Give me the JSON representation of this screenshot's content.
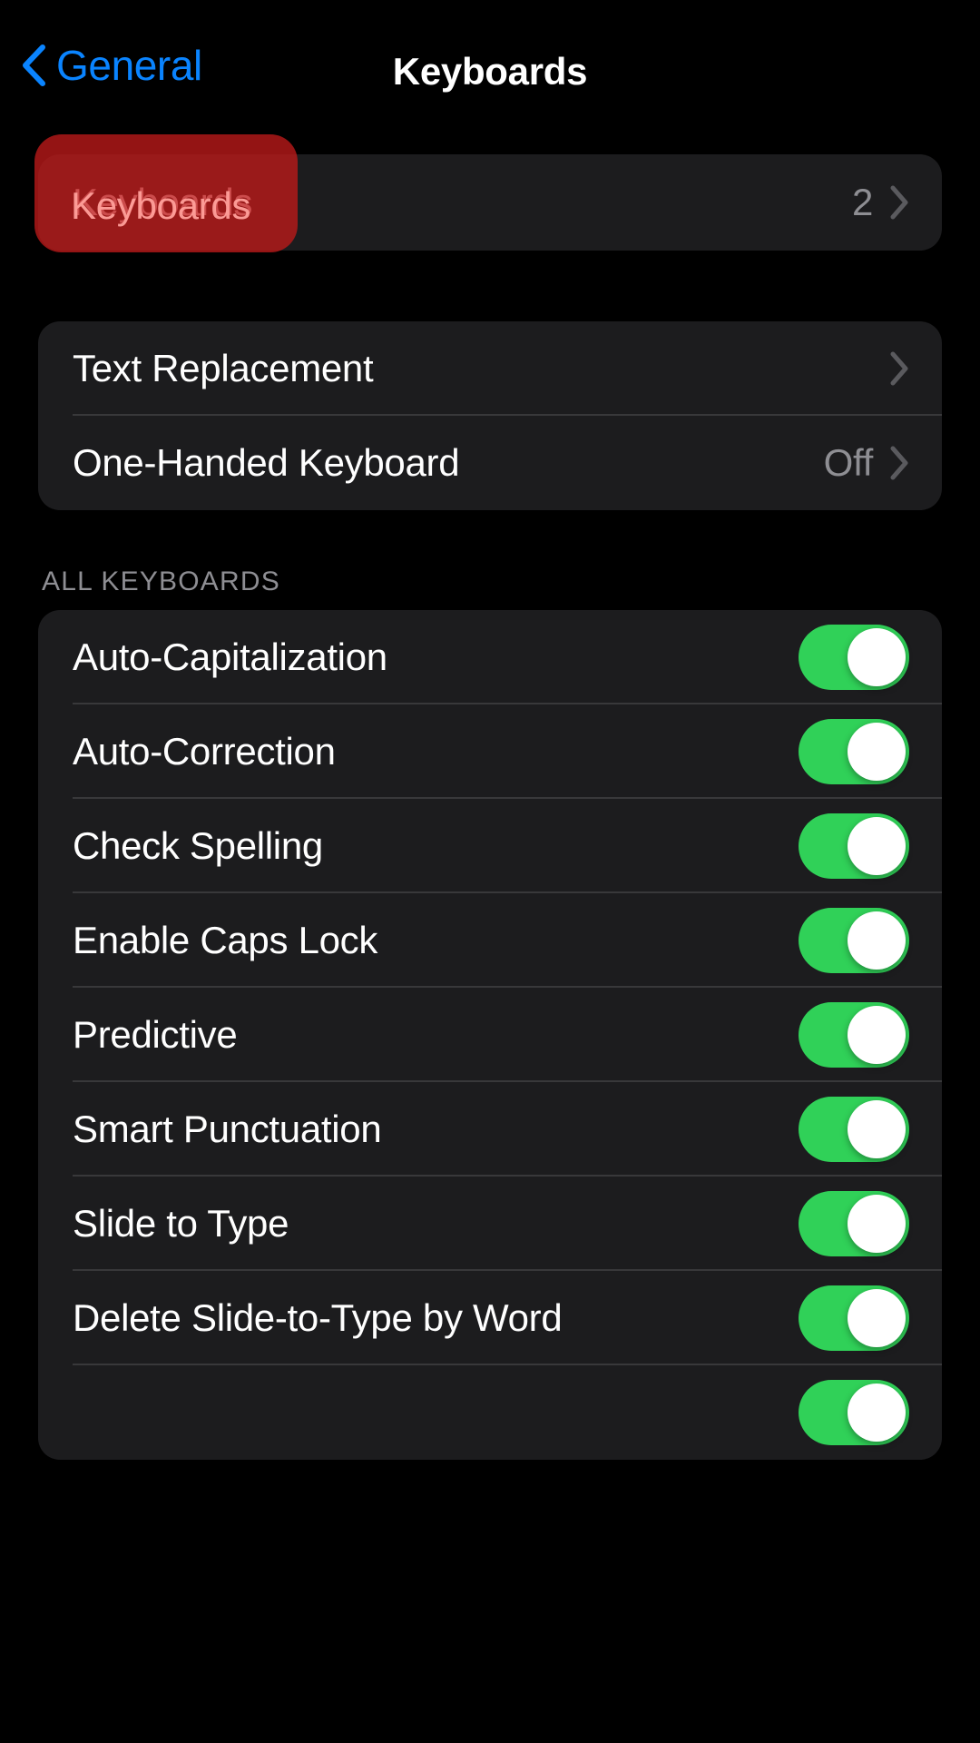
{
  "nav": {
    "back_label": "General",
    "title": "Keyboards",
    "back_icon": "chevron-left-icon",
    "accent_color": "#0A84FF"
  },
  "highlight": {
    "label": "Keyboards",
    "color": "#BE1919"
  },
  "keyboards_card": {
    "rows": [
      {
        "label": "Keyboards",
        "value": "2",
        "icon": "chevron-right-icon"
      }
    ]
  },
  "options_card": {
    "rows": [
      {
        "label": "Text Replacement",
        "value": "",
        "icon": "chevron-right-icon"
      },
      {
        "label": "One-Handed Keyboard",
        "value": "Off",
        "icon": "chevron-right-icon"
      }
    ]
  },
  "all_keyboards": {
    "header": "ALL KEYBOARDS",
    "toggle_on_color": "#30D158",
    "rows": [
      {
        "label": "Auto-Capitalization",
        "state": "on"
      },
      {
        "label": "Auto-Correction",
        "state": "on"
      },
      {
        "label": "Check Spelling",
        "state": "on"
      },
      {
        "label": "Enable Caps Lock",
        "state": "on"
      },
      {
        "label": "Predictive",
        "state": "on"
      },
      {
        "label": "Smart Punctuation",
        "state": "on"
      },
      {
        "label": "Slide to Type",
        "state": "on"
      },
      {
        "label": "Delete Slide-to-Type by Word",
        "state": "on"
      },
      {
        "label": "",
        "state": "on"
      }
    ]
  }
}
